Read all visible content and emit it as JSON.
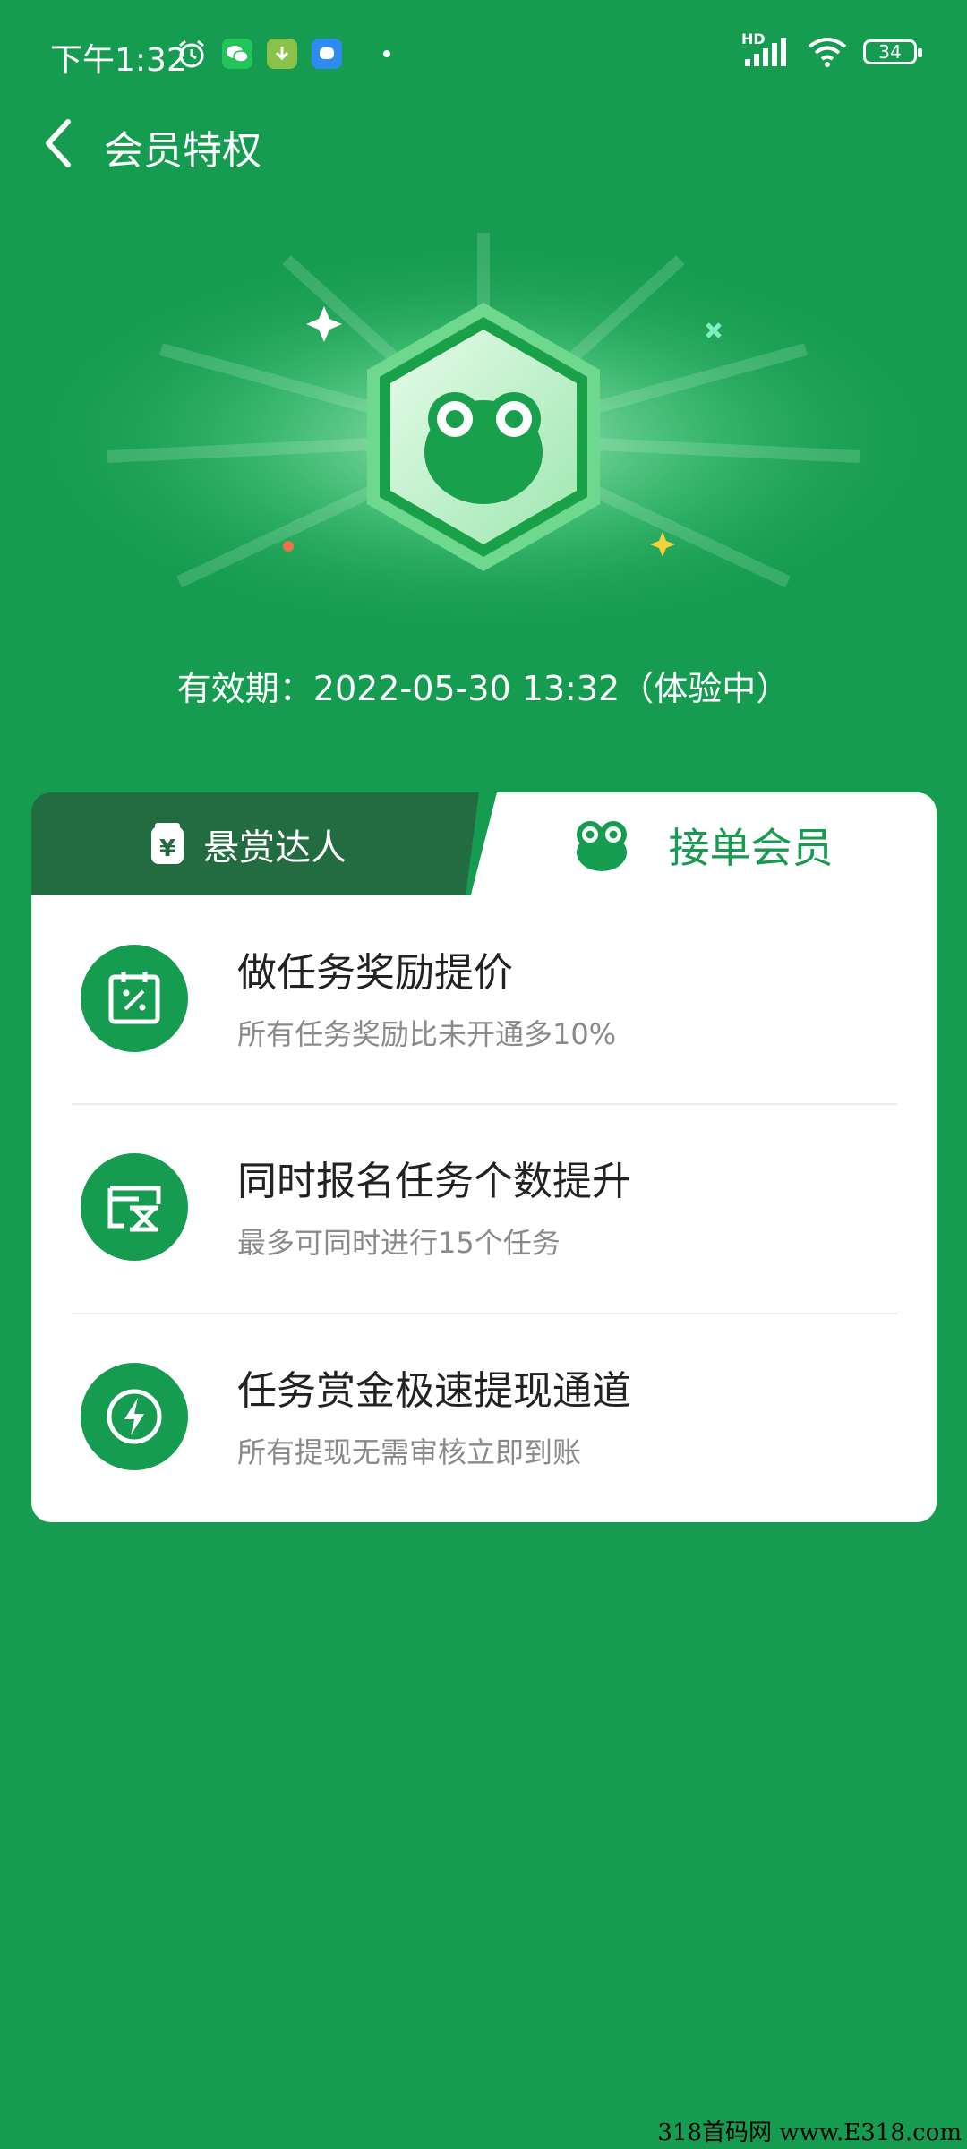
{
  "status_bar": {
    "time": "下午1:32",
    "signal_label": "HD",
    "battery": "34"
  },
  "header": {
    "title": "会员特权"
  },
  "validity": "有效期：2022-05-30 13:32（体验中）",
  "tabs": [
    {
      "label": "悬赏达人",
      "icon": "bounty-bag-icon",
      "active": false
    },
    {
      "label": "接单会员",
      "icon": "frog-icon",
      "active": true
    }
  ],
  "benefits": [
    {
      "title": "做任务奖励提价",
      "subtitle": "所有任务奖励比未开通多10%",
      "icon": "discount-calendar-icon"
    },
    {
      "title": "同时报名任务个数提升",
      "subtitle": "最多可同时进行15个任务",
      "icon": "hourglass-card-icon"
    },
    {
      "title": "任务赏金极速提现通道",
      "subtitle": "所有提现无需审核立即到账",
      "icon": "lightning-icon"
    }
  ],
  "watermark": "318首码网 www.E318.com",
  "colors": {
    "primary": "#169c50",
    "tab_inactive": "#236b40",
    "text_dark": "#222222",
    "text_muted": "#8a8a8a"
  }
}
